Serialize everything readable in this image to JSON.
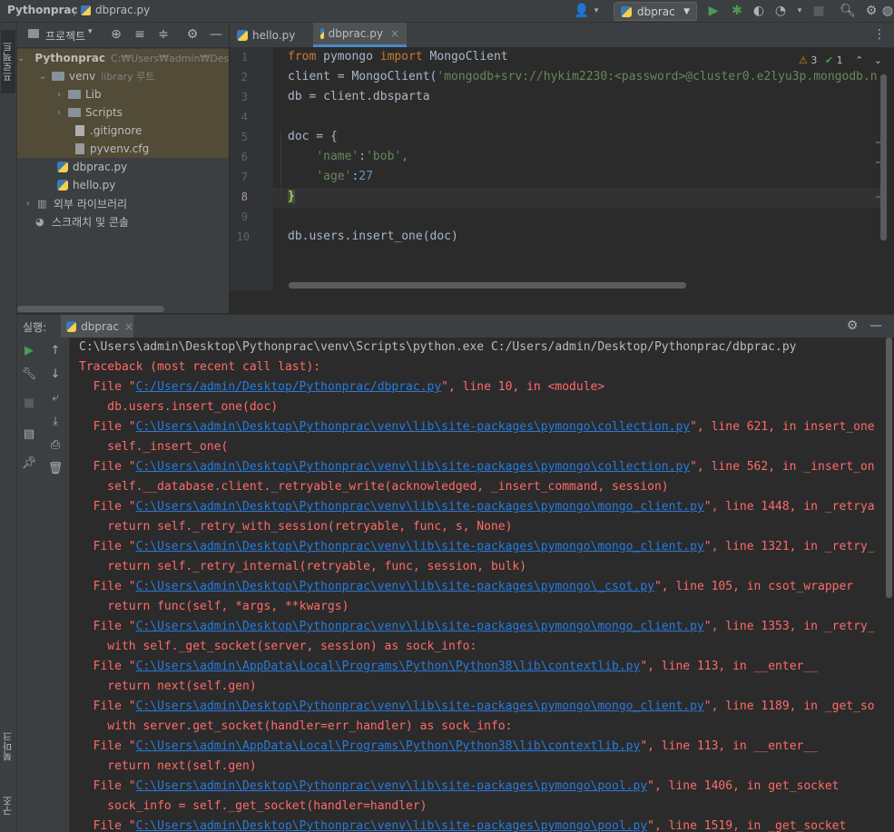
{
  "titlebar": {
    "project": "Pythonprac",
    "file": "dbprac.py",
    "run_config": "dbprac"
  },
  "left_strip": {
    "project_tab": "프로젝트",
    "bookmark_tab": "북마크",
    "structure_tab": "구조"
  },
  "project_panel": {
    "title": "프로젝트",
    "tree": [
      {
        "name": "Pythonprac",
        "extra": "C:₩Users₩admin₩Des",
        "level": 0,
        "type": "folder",
        "expanded": true
      },
      {
        "name": "venv",
        "extra": "library 루트",
        "level": 1,
        "type": "folder",
        "expanded": true
      },
      {
        "name": "Lib",
        "extra": "",
        "level": 2,
        "type": "folder",
        "expanded": false
      },
      {
        "name": "Scripts",
        "extra": "",
        "level": 2,
        "type": "folder",
        "expanded": false
      },
      {
        "name": ".gitignore",
        "extra": "",
        "level": 2,
        "type": "file"
      },
      {
        "name": "pyvenv.cfg",
        "extra": "",
        "level": 2,
        "type": "file"
      },
      {
        "name": "dbprac.py",
        "extra": "",
        "level": 1,
        "type": "python"
      },
      {
        "name": "hello.py",
        "extra": "",
        "level": 1,
        "type": "python"
      },
      {
        "name": "외부 라이브러리",
        "extra": "",
        "level": 0,
        "type": "library"
      },
      {
        "name": "스크래치 및 콘솔",
        "extra": "",
        "level": 0,
        "type": "scratch"
      }
    ]
  },
  "editor": {
    "tabs": [
      {
        "label": "hello.py",
        "active": false
      },
      {
        "label": "dbprac.py",
        "active": true
      }
    ],
    "inspections": {
      "warnings": "3",
      "ok": "1"
    },
    "line_numbers": [
      "1",
      "2",
      "3",
      "4",
      "5",
      "6",
      "7",
      "8",
      "9",
      "10"
    ],
    "code": {
      "l1_from": "from",
      "l1_mod": " pymongo ",
      "l1_import": "import",
      "l1_rest": " MongoClient",
      "l2_a": "client = MongoClient(",
      "l2_str": "'mongodb+srv://hykim2230:<password>@cluster0.e2lyu3p.mongodb.n",
      "l3": "db = client.dbsparta",
      "l5": "doc = {",
      "l6_key": "'name'",
      "l6_sep": ":",
      "l6_val": "'bob'",
      "l6_end": ",",
      "l7_key": "'age'",
      "l7_sep": ":",
      "l7_val": "27",
      "l8": "}",
      "l10": "db.users.insert_one(doc)"
    }
  },
  "run_panel": {
    "label": "실행:",
    "tab": "dbprac",
    "console": {
      "command": "C:\\Users\\admin\\Desktop\\Pythonprac\\venv\\Scripts\\python.exe C:/Users/admin/Desktop/Pythonprac/dbprac.py",
      "traceback_header": "Traceback (most recent call last):",
      "frames": [
        {
          "prefix": "  File \"",
          "path": "C:/Users/admin/Desktop/Pythonprac/dbprac.py",
          "suffix": "\", line 10, in <module>",
          "code": "    db.users.insert_one(doc)"
        },
        {
          "prefix": "  File \"",
          "path": "C:\\Users\\admin\\Desktop\\Pythonprac\\venv\\lib\\site-packages\\pymongo\\collection.py",
          "suffix": "\", line 621, in insert_one",
          "code": "    self._insert_one("
        },
        {
          "prefix": "  File \"",
          "path": "C:\\Users\\admin\\Desktop\\Pythonprac\\venv\\lib\\site-packages\\pymongo\\collection.py",
          "suffix": "\", line 562, in _insert_on",
          "code": "    self.__database.client._retryable_write(acknowledged, _insert_command, session)"
        },
        {
          "prefix": "  File \"",
          "path": "C:\\Users\\admin\\Desktop\\Pythonprac\\venv\\lib\\site-packages\\pymongo\\mongo_client.py",
          "suffix": "\", line 1448, in _retrya",
          "code": "    return self._retry_with_session(retryable, func, s, None)"
        },
        {
          "prefix": "  File \"",
          "path": "C:\\Users\\admin\\Desktop\\Pythonprac\\venv\\lib\\site-packages\\pymongo\\mongo_client.py",
          "suffix": "\", line 1321, in _retry_",
          "code": "    return self._retry_internal(retryable, func, session, bulk)"
        },
        {
          "prefix": "  File \"",
          "path": "C:\\Users\\admin\\Desktop\\Pythonprac\\venv\\lib\\site-packages\\pymongo\\_csot.py",
          "suffix": "\", line 105, in csot_wrapper",
          "code": "    return func(self, *args, **kwargs)"
        },
        {
          "prefix": "  File \"",
          "path": "C:\\Users\\admin\\Desktop\\Pythonprac\\venv\\lib\\site-packages\\pymongo\\mongo_client.py",
          "suffix": "\", line 1353, in _retry_",
          "code": "    with self._get_socket(server, session) as sock_info:"
        },
        {
          "prefix": "  File \"",
          "path": "C:\\Users\\admin\\AppData\\Local\\Programs\\Python\\Python38\\lib\\contextlib.py",
          "suffix": "\", line 113, in __enter__",
          "code": "    return next(self.gen)"
        },
        {
          "prefix": "  File \"",
          "path": "C:\\Users\\admin\\Desktop\\Pythonprac\\venv\\lib\\site-packages\\pymongo\\mongo_client.py",
          "suffix": "\", line 1189, in _get_so",
          "code": "    with server.get_socket(handler=err_handler) as sock_info:"
        },
        {
          "prefix": "  File \"",
          "path": "C:\\Users\\admin\\AppData\\Local\\Programs\\Python\\Python38\\lib\\contextlib.py",
          "suffix": "\", line 113, in __enter__",
          "code": "    return next(self.gen)"
        },
        {
          "prefix": "  File \"",
          "path": "C:\\Users\\admin\\Desktop\\Pythonprac\\venv\\lib\\site-packages\\pymongo\\pool.py",
          "suffix": "\", line 1406, in get_socket",
          "code": "    sock_info = self._get_socket(handler=handler)"
        },
        {
          "prefix": "  File \"",
          "path": "C:\\Users\\admin\\Desktop\\Pythonprac\\venv\\lib\\site-packages\\pymongo\\pool.py",
          "suffix": "\", line 1519, in _get_socket",
          "code": ""
        }
      ]
    }
  },
  "colors": {
    "accent": "#4a88c7",
    "error_text": "#ff6b68",
    "link": "#287bde",
    "run_green": "#499c54"
  }
}
